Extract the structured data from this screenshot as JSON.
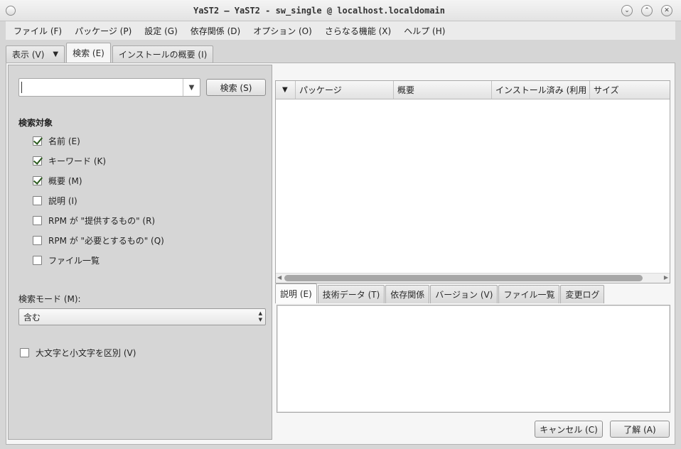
{
  "window": {
    "title": "YaST2 — YaST2 - sw_single @ localhost.localdomain"
  },
  "titlebar_buttons": {
    "minimize": "⌄",
    "maximize": "⌃",
    "close": "✕"
  },
  "menubar": {
    "items": [
      "ファイル (F)",
      "パッケージ (P)",
      "設定 (G)",
      "依存関係 (D)",
      "オプション (O)",
      "さらなる機能 (X)",
      "ヘルプ (H)"
    ]
  },
  "main_tabs": {
    "view_label": "表示 (V)",
    "view_arrow": "▼",
    "search_label": "検索 (E)",
    "install_summary_label": "インストールの概要 (I)"
  },
  "search": {
    "input_value": "",
    "dropdown_arrow": "▼",
    "button_label": "検索 (S)",
    "target_heading": "検索対象",
    "targets": [
      {
        "label": "名前 (E)",
        "checked": true
      },
      {
        "label": "キーワード (K)",
        "checked": true
      },
      {
        "label": "概要 (M)",
        "checked": true
      },
      {
        "label": "説明 (I)",
        "checked": false
      },
      {
        "label": "RPM が \"提供するもの\" (R)",
        "checked": false
      },
      {
        "label": "RPM が \"必要とするもの\" (Q)",
        "checked": false
      },
      {
        "label": "ファイル一覧",
        "checked": false
      }
    ],
    "mode_label": "検索モード (M):",
    "mode_value": "含む",
    "case_sensitive_label": "大文字と小文字を区別 (V)",
    "case_sensitive_checked": false
  },
  "package_table": {
    "sort_arrow": "▼",
    "columns": [
      "パッケージ",
      "概要",
      "インストール済み (利用",
      "サイズ"
    ],
    "scroll_left": "◀",
    "scroll_right": "▶"
  },
  "detail_tabs": {
    "tabs": [
      "説明 (E)",
      "技術データ (T)",
      "依存関係",
      "バージョン (V)",
      "ファイル一覧",
      "変更ログ"
    ],
    "active_index": 0
  },
  "footer": {
    "cancel_label": "キャンセル (C)",
    "ok_label": "了解 (A)"
  }
}
